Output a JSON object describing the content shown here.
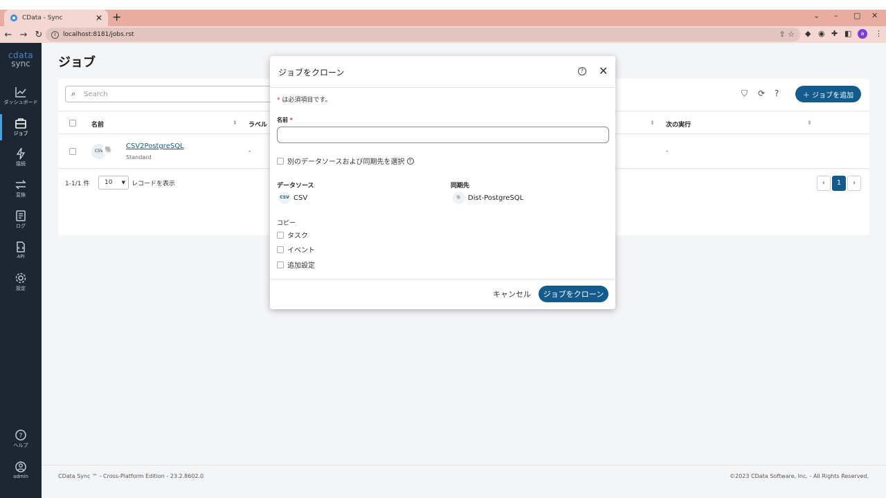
{
  "browser": {
    "tab_title": "CData - Sync",
    "url": "localhost:8181/jobs.rst",
    "avatar_letter": "a"
  },
  "sidebar": {
    "logo_top": "cdata",
    "logo_bottom": "sync",
    "items": [
      {
        "label": "ダッシュボード",
        "icon": "chart-icon"
      },
      {
        "label": "ジョブ",
        "icon": "briefcase-icon"
      },
      {
        "label": "接続",
        "icon": "lightning-icon"
      },
      {
        "label": "変換",
        "icon": "transform-icon"
      },
      {
        "label": "ログ",
        "icon": "log-icon"
      },
      {
        "label": "API",
        "icon": "api-icon"
      },
      {
        "label": "設定",
        "icon": "gear-icon"
      }
    ],
    "help_label": "ヘルプ",
    "user_label": "admin"
  },
  "main": {
    "title": "ジョブ",
    "search_placeholder": "Search",
    "add_button": "＋ ジョブを追加",
    "columns": [
      "名前",
      "ラベル",
      "次の実行"
    ],
    "row": {
      "name": "CSV2PostgreSQL",
      "sub": "Standard",
      "label": "-",
      "next_run": "-"
    },
    "pager": {
      "count": "1-1/1 件",
      "per_page": "10",
      "per_page_suffix": "レコードを表示",
      "current": "1"
    }
  },
  "footer": {
    "left": "CData Sync ™ - Cross-Platform Edition - 23.2.8602.0",
    "right": "©2023 CData Software, Inc. - All Rights Reserved."
  },
  "modal": {
    "title": "ジョブをクローン",
    "required_note": "は必須項目です。",
    "name_label": "名前",
    "name_value": "",
    "alt_select": "別のデータソースおよび同期先を選択",
    "source_head": "データソース",
    "source_name": "CSV",
    "dest_head": "同期先",
    "dest_name": "Dist-PostgreSQL",
    "copy_head": "コピー",
    "copy_options": [
      "タスク",
      "イベント",
      "追加設定"
    ],
    "cancel": "キャンセル",
    "submit": "ジョブをクローン"
  }
}
